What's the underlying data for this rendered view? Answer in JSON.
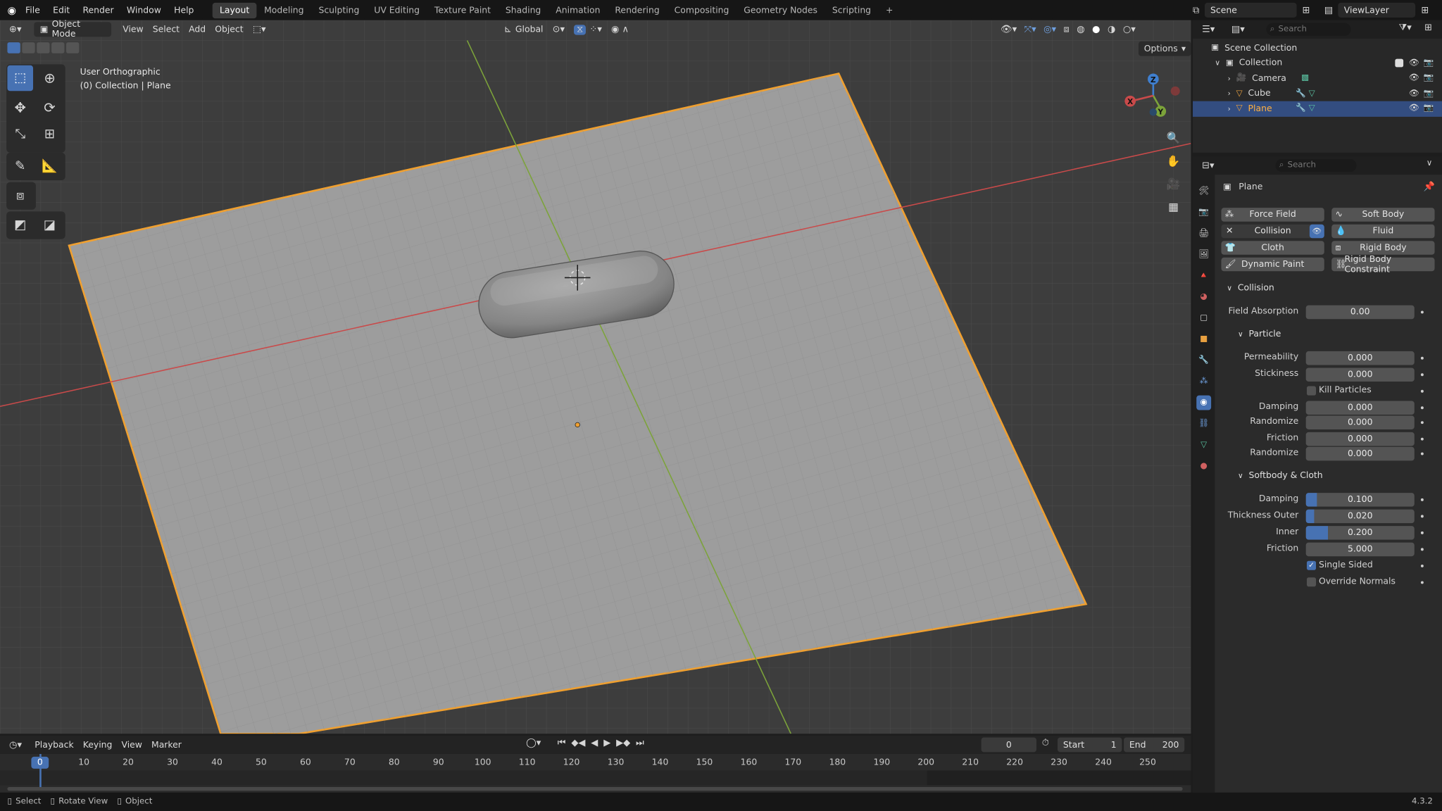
{
  "topbar": {
    "menus": [
      "File",
      "Edit",
      "Render",
      "Window",
      "Help"
    ],
    "workspaces": [
      "Layout",
      "Modeling",
      "Sculpting",
      "UV Editing",
      "Texture Paint",
      "Shading",
      "Animation",
      "Rendering",
      "Compositing",
      "Geometry Nodes",
      "Scripting"
    ],
    "active_workspace": "Layout",
    "add_tab": "+",
    "scene": "Scene",
    "view_layer": "ViewLayer"
  },
  "viewport": {
    "mode": "Object Mode",
    "menus": [
      "View",
      "Select",
      "Add",
      "Object"
    ],
    "orientation": "Global",
    "options": "Options",
    "view_name": "User Orthographic",
    "context": "(0) Collection | Plane",
    "gizmo": {
      "x": "X",
      "y": "Y",
      "z": "Z"
    }
  },
  "outliner": {
    "search_placeholder": "Search",
    "scene_collection": "Scene Collection",
    "collection": "Collection",
    "items": [
      "Camera",
      "Cube",
      "Plane"
    ],
    "selected": "Plane"
  },
  "properties": {
    "search_placeholder": "Search",
    "object_name": "Plane",
    "physics_buttons": {
      "force_field": "Force Field",
      "soft_body": "Soft Body",
      "collision": "Collision",
      "fluid": "Fluid",
      "cloth": "Cloth",
      "rigid_body": "Rigid Body",
      "dynamic_paint": "Dynamic Paint",
      "rigid_body_constraint": "Rigid Body Constraint"
    },
    "collision_section": "Collision",
    "field_absorption": {
      "label": "Field Absorption",
      "value": "0.00"
    },
    "particle_section": "Particle",
    "permeability": {
      "label": "Permeability",
      "value": "0.000"
    },
    "stickiness": {
      "label": "Stickiness",
      "value": "0.000"
    },
    "kill_particles": {
      "label": "Kill Particles",
      "checked": false
    },
    "damping": {
      "label": "Damping",
      "value": "0.000"
    },
    "randomize1": {
      "label": "Randomize",
      "value": "0.000"
    },
    "friction": {
      "label": "Friction",
      "value": "0.000"
    },
    "randomize2": {
      "label": "Randomize",
      "value": "0.000"
    },
    "softbody_section": "Softbody & Cloth",
    "sb_damping": {
      "label": "Damping",
      "value": "0.100",
      "fill": 0.1
    },
    "thickness_outer": {
      "label": "Thickness Outer",
      "value": "0.020",
      "fill": 0.02
    },
    "inner": {
      "label": "Inner",
      "value": "0.200",
      "fill": 0.2
    },
    "sb_friction": {
      "label": "Friction",
      "value": "5.000"
    },
    "single_sided": {
      "label": "Single Sided",
      "checked": true
    },
    "override_normals": {
      "label": "Override Normals",
      "checked": false
    }
  },
  "timeline": {
    "menus": [
      "Playback",
      "Keying",
      "View",
      "Marker"
    ],
    "current_frame": "0",
    "start_label": "Start",
    "start": "1",
    "end_label": "End",
    "end": "200",
    "ticks": [
      "0",
      "10",
      "20",
      "30",
      "40",
      "50",
      "60",
      "70",
      "80",
      "90",
      "100",
      "110",
      "120",
      "130",
      "140",
      "150",
      "160",
      "170",
      "180",
      "190",
      "200",
      "210",
      "220",
      "230",
      "240",
      "250"
    ]
  },
  "statusbar": {
    "select": "Select",
    "rotate_view": "Rotate View",
    "object": "Object",
    "version": "4.3.2"
  },
  "colors": {
    "accent": "#4772b3",
    "selection_outline": "#f0a030",
    "x_axis": "#c94a4a",
    "y_axis": "#7ca33a",
    "z_axis": "#3f7fcf"
  }
}
